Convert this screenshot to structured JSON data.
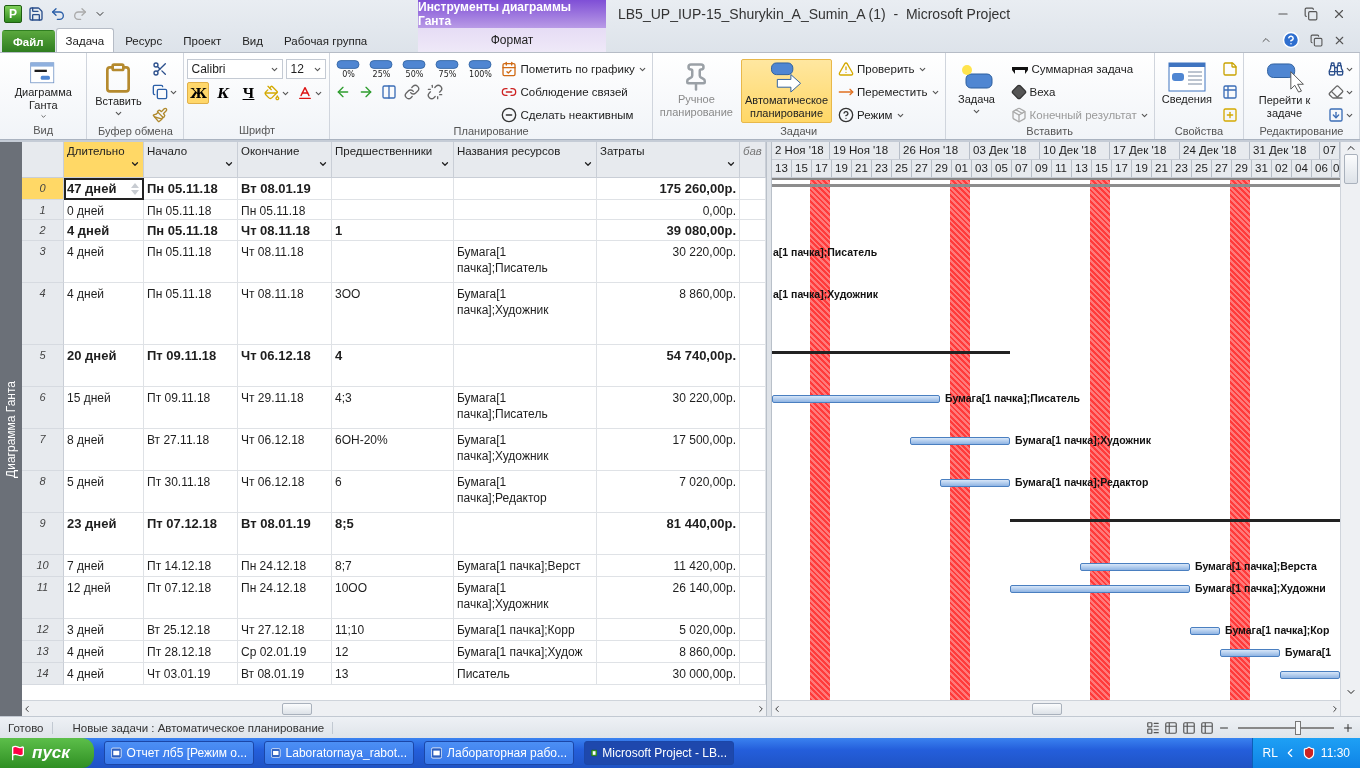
{
  "window": {
    "logo": "P",
    "title": "LB5_UP_IUP-15_Shurykin_A_Sumin_A (1)  -  Microsoft Project",
    "context_title": "Инструменты диаграммы Ганта"
  },
  "tabs": [
    {
      "label": "Файл",
      "kind": "file",
      "selected": false
    },
    {
      "label": "Задача",
      "kind": "tab",
      "selected": true
    },
    {
      "label": "Ресурс",
      "kind": "tab",
      "selected": false
    },
    {
      "label": "Проект",
      "kind": "tab",
      "selected": false
    },
    {
      "label": "Вид",
      "kind": "tab",
      "selected": false
    },
    {
      "label": "Рабочая группа",
      "kind": "tab",
      "selected": false
    }
  ],
  "context_tab": {
    "label": "Формат",
    "selected": false
  },
  "ribbon": [
    {
      "label": "Вид",
      "columns": [
        [
          [
            {
              "kind": "large",
              "label": "Диаграмма Ганта",
              "dropdown": true,
              "selected": false,
              "disabled": false
            }
          ]
        ]
      ]
    },
    {
      "label": "Буфер обмена",
      "columns": [
        [
          [
            {
              "kind": "large",
              "label": "Вставить",
              "dropdown": true,
              "selected": false,
              "disabled": false
            }
          ]
        ],
        [
          [
            {
              "kind": "icon",
              "dropdown": false
            }
          ],
          [
            {
              "kind": "icon",
              "dropdown": true
            }
          ],
          [
            {
              "kind": "icon",
              "dropdown": false
            }
          ]
        ]
      ]
    },
    {
      "label": "Шрифт",
      "columns": [
        [
          [
            {
              "kind": "field",
              "value": "Calibri"
            },
            {
              "kind": "field",
              "value": "12"
            }
          ],
          [
            {
              "kind": "toggle",
              "label": "Ж",
              "selected": true
            },
            {
              "kind": "toggle",
              "label": "К",
              "selected": false
            },
            {
              "kind": "toggle",
              "label": "Ч",
              "selected": false
            },
            {
              "kind": "icon",
              "dropdown": true
            },
            {
              "kind": "icon",
              "dropdown": true
            }
          ]
        ]
      ]
    },
    {
      "label": "Планирование",
      "columns": [
        [
          [
            {
              "kind": "percent",
              "label": "0%"
            },
            {
              "kind": "percent",
              "label": "25%"
            },
            {
              "kind": "percent",
              "label": "50%"
            },
            {
              "kind": "percent",
              "label": "75%"
            },
            {
              "kind": "percent",
              "label": "100%"
            }
          ],
          [
            {
              "kind": "icon",
              "dropdown": false
            },
            {
              "kind": "icon",
              "dropdown": false
            },
            {
              "kind": "icon",
              "dropdown": false
            },
            {
              "kind": "icon",
              "dropdown": false
            },
            {
              "kind": "icon",
              "dropdown": false
            }
          ]
        ],
        [
          [
            {
              "kind": "small",
              "label": "Пометить по графику",
              "dropdown": true,
              "disabled": false
            }
          ],
          [
            {
              "kind": "small",
              "label": "Соблюдение связей",
              "dropdown": false,
              "disabled": false
            }
          ],
          [
            {
              "kind": "small",
              "label": "Сделать неактивным",
              "dropdown": false,
              "disabled": false
            }
          ]
        ]
      ]
    },
    {
      "label": "Задачи",
      "columns": [
        [
          [
            {
              "kind": "large",
              "label": "Ручное планирование",
              "dropdown": false,
              "selected": false,
              "disabled": true
            }
          ]
        ],
        [
          [
            {
              "kind": "large",
              "label": "Автоматическое планирование",
              "dropdown": false,
              "selected": true,
              "disabled": false
            }
          ]
        ],
        [
          [
            {
              "kind": "small",
              "label": "Проверить",
              "dropdown": true,
              "disabled": false
            }
          ],
          [
            {
              "kind": "small",
              "label": "Переместить",
              "dropdown": true,
              "disabled": false
            }
          ],
          [
            {
              "kind": "small",
              "label": "Режим",
              "dropdown": true,
              "disabled": false
            }
          ]
        ]
      ]
    },
    {
      "label": "Вставить",
      "columns": [
        [
          [
            {
              "kind": "large",
              "label": "Задача",
              "dropdown": true,
              "selected": false,
              "disabled": false
            }
          ]
        ],
        [
          [
            {
              "kind": "small",
              "label": "Суммарная задача",
              "dropdown": false,
              "disabled": false
            }
          ],
          [
            {
              "kind": "small",
              "label": "Веха",
              "dropdown": false,
              "disabled": false
            }
          ],
          [
            {
              "kind": "small",
              "label": "Конечный результат",
              "dropdown": true,
              "disabled": true
            }
          ]
        ]
      ]
    },
    {
      "label": "Свойства",
      "columns": [
        [
          [
            {
              "kind": "large",
              "label": "Сведения",
              "dropdown": false,
              "selected": false,
              "disabled": false
            }
          ]
        ],
        [
          [
            {
              "kind": "icon",
              "dropdown": false
            }
          ],
          [
            {
              "kind": "icon",
              "dropdown": false
            }
          ],
          [
            {
              "kind": "icon",
              "dropdown": false
            }
          ]
        ]
      ]
    },
    {
      "label": "Редактирование",
      "columns": [
        [
          [
            {
              "kind": "large",
              "label": "Перейти к задаче",
              "dropdown": false,
              "selected": false,
              "disabled": false
            }
          ]
        ],
        [
          [
            {
              "kind": "icon",
              "dropdown": true
            }
          ],
          [
            {
              "kind": "icon",
              "dropdown": true
            }
          ],
          [
            {
              "kind": "icon",
              "dropdown": true
            }
          ]
        ]
      ]
    }
  ],
  "side_label": "Диаграмма Ганта",
  "table": {
    "columns": [
      {
        "label": "Длительно",
        "selected": true
      },
      {
        "label": "Начало",
        "selected": false
      },
      {
        "label": "Окончание",
        "selected": false
      },
      {
        "label": "Предшественники",
        "selected": false
      },
      {
        "label": "Названия ресурсов",
        "selected": false
      },
      {
        "label": "Затраты",
        "selected": false
      },
      {
        "label": "бав",
        "selected": false
      }
    ],
    "rows": [
      {
        "id": "0",
        "duration": "47 дней",
        "start": "Пн 05.11.18",
        "finish": "Вт 08.01.19",
        "cost": "175 260,00р.",
        "summary": true,
        "selected": true
      },
      {
        "id": "1",
        "duration": "0 дней",
        "start": "Пн 05.11.18",
        "finish": "Пн 05.11.18",
        "cost": "0,00р.",
        "summary": false,
        "selected": false
      },
      {
        "id": "2",
        "duration": "4 дней",
        "start": "Пн 05.11.18",
        "finish": "Чт 08.11.18",
        "predecessors": "1",
        "cost": "39 080,00р.",
        "summary": true,
        "selected": false
      },
      {
        "id": "3",
        "duration": "4 дней",
        "start": "Пн 05.11.18",
        "finish": "Чт 08.11.18",
        "resources": "Бумага[1 пачка];Писатель",
        "cost": "30 220,00р.",
        "summary": false,
        "selected": false,
        "bar_label": "а[1 пачка];Писатель"
      },
      {
        "id": "4",
        "duration": "4 дней",
        "start": "Пн 05.11.18",
        "finish": "Чт 08.11.18",
        "predecessors": "3ОО",
        "resources": "Бумага[1 пачка];Художник",
        "cost": "8 860,00р.",
        "summary": false,
        "selected": false,
        "bar_label": "а[1 пачка];Художник"
      },
      {
        "id": "5",
        "duration": "20 дней",
        "start": "Пт 09.11.18",
        "finish": "Чт 06.12.18",
        "predecessors": "4",
        "cost": "54 740,00р.",
        "summary": true,
        "selected": false
      },
      {
        "id": "6",
        "duration": "15 дней",
        "start": "Пт 09.11.18",
        "finish": "Чт 29.11.18",
        "predecessors": "4;3",
        "resources": "Бумага[1 пачка];Писатель",
        "cost": "30 220,00р.",
        "summary": false,
        "selected": false,
        "bar_label": "Бумага[1 пачка];Писатель"
      },
      {
        "id": "7",
        "duration": "8 дней",
        "start": "Вт 27.11.18",
        "finish": "Чт 06.12.18",
        "predecessors": "6ОН-20%",
        "resources": "Бумага[1 пачка];Художник",
        "cost": "17 500,00р.",
        "summary": false,
        "selected": false,
        "bar_label": "Бумага[1 пачка];Художник"
      },
      {
        "id": "8",
        "duration": "5 дней",
        "start": "Пт 30.11.18",
        "finish": "Чт 06.12.18",
        "predecessors": "6",
        "resources": "Бумага[1 пачка];Редактор",
        "cost": "7 020,00р.",
        "summary": false,
        "selected": false,
        "bar_label": "Бумага[1 пачка];Редактор"
      },
      {
        "id": "9",
        "duration": "23 дней",
        "start": "Пт 07.12.18",
        "finish": "Вт 08.01.19",
        "predecessors": "8;5",
        "cost": "81 440,00р.",
        "summary": true,
        "selected": false
      },
      {
        "id": "10",
        "duration": "7 дней",
        "start": "Пт 14.12.18",
        "finish": "Пн 24.12.18",
        "predecessors": "8;7",
        "resources": "Бумага[1 пачка];Верст",
        "cost": "11 420,00р.",
        "summary": false,
        "selected": false,
        "bar_label": "Бумага[1 пачка];Верста"
      },
      {
        "id": "11",
        "duration": "12 дней",
        "start": "Пт 07.12.18",
        "finish": "Пн 24.12.18",
        "predecessors": "10ОО",
        "resources": "Бумага[1 пачка];Художник",
        "cost": "26 140,00р.",
        "summary": false,
        "selected": false,
        "bar_label": "Бумага[1 пачка];Художни"
      },
      {
        "id": "12",
        "duration": "3 дней",
        "start": "Вт 25.12.18",
        "finish": "Чт 27.12.18",
        "predecessors": "11;10",
        "resources": "Бумага[1 пачка];Корр",
        "cost": "5 020,00р.",
        "summary": false,
        "selected": false,
        "bar_label": "Бумага[1 пачка];Кор"
      },
      {
        "id": "13",
        "duration": "4 дней",
        "start": "Пт 28.12.18",
        "finish": "Ср 02.01.19",
        "predecessors": "12",
        "resources": "Бумага[1 пачка];Худож",
        "cost": "8 860,00р.",
        "summary": false,
        "selected": false,
        "bar_label": "Бумага[1"
      },
      {
        "id": "14",
        "duration": "4 дней",
        "start": "Чт 03.01.19",
        "finish": "Вт 08.01.19",
        "predecessors": "13",
        "resources": "Писатель",
        "cost": "30 000,00р.",
        "summary": false,
        "selected": false
      }
    ]
  },
  "gantt": {
    "weeks": [
      "2 Ноя '18",
      "19 Ноя '18",
      "26 Ноя '18",
      "03 Дек '18",
      "10 Дек '18",
      "17 Дек '18",
      "24 Дек '18",
      "31 Дек '18",
      "07"
    ],
    "days": [
      "13",
      "15",
      "17",
      "19",
      "21",
      "23",
      "25",
      "27",
      "29",
      "01",
      "03",
      "05",
      "07",
      "09",
      "11",
      "13",
      "15",
      "17",
      "19",
      "21",
      "23",
      "25",
      "27",
      "29",
      "31",
      "02",
      "04",
      "06",
      "0"
    ]
  },
  "status_bar": {
    "ready": "Готово",
    "mode": "Новые задачи : Автоматическое планирование",
    "zoom": {
      "level": 0.63
    }
  },
  "taskbar": {
    "start": "пуск",
    "items": [
      {
        "label": "Отчет лб5 [Режим о...",
        "kind": "word",
        "selected": false
      },
      {
        "label": "Laboratornaya_rabot...",
        "kind": "word",
        "selected": false
      },
      {
        "label": "Лабораторная рабо...",
        "kind": "word",
        "selected": false
      },
      {
        "label": "Microsoft Project - LB...",
        "kind": "project",
        "selected": true
      }
    ],
    "language": "RL",
    "clock": "11:30"
  }
}
